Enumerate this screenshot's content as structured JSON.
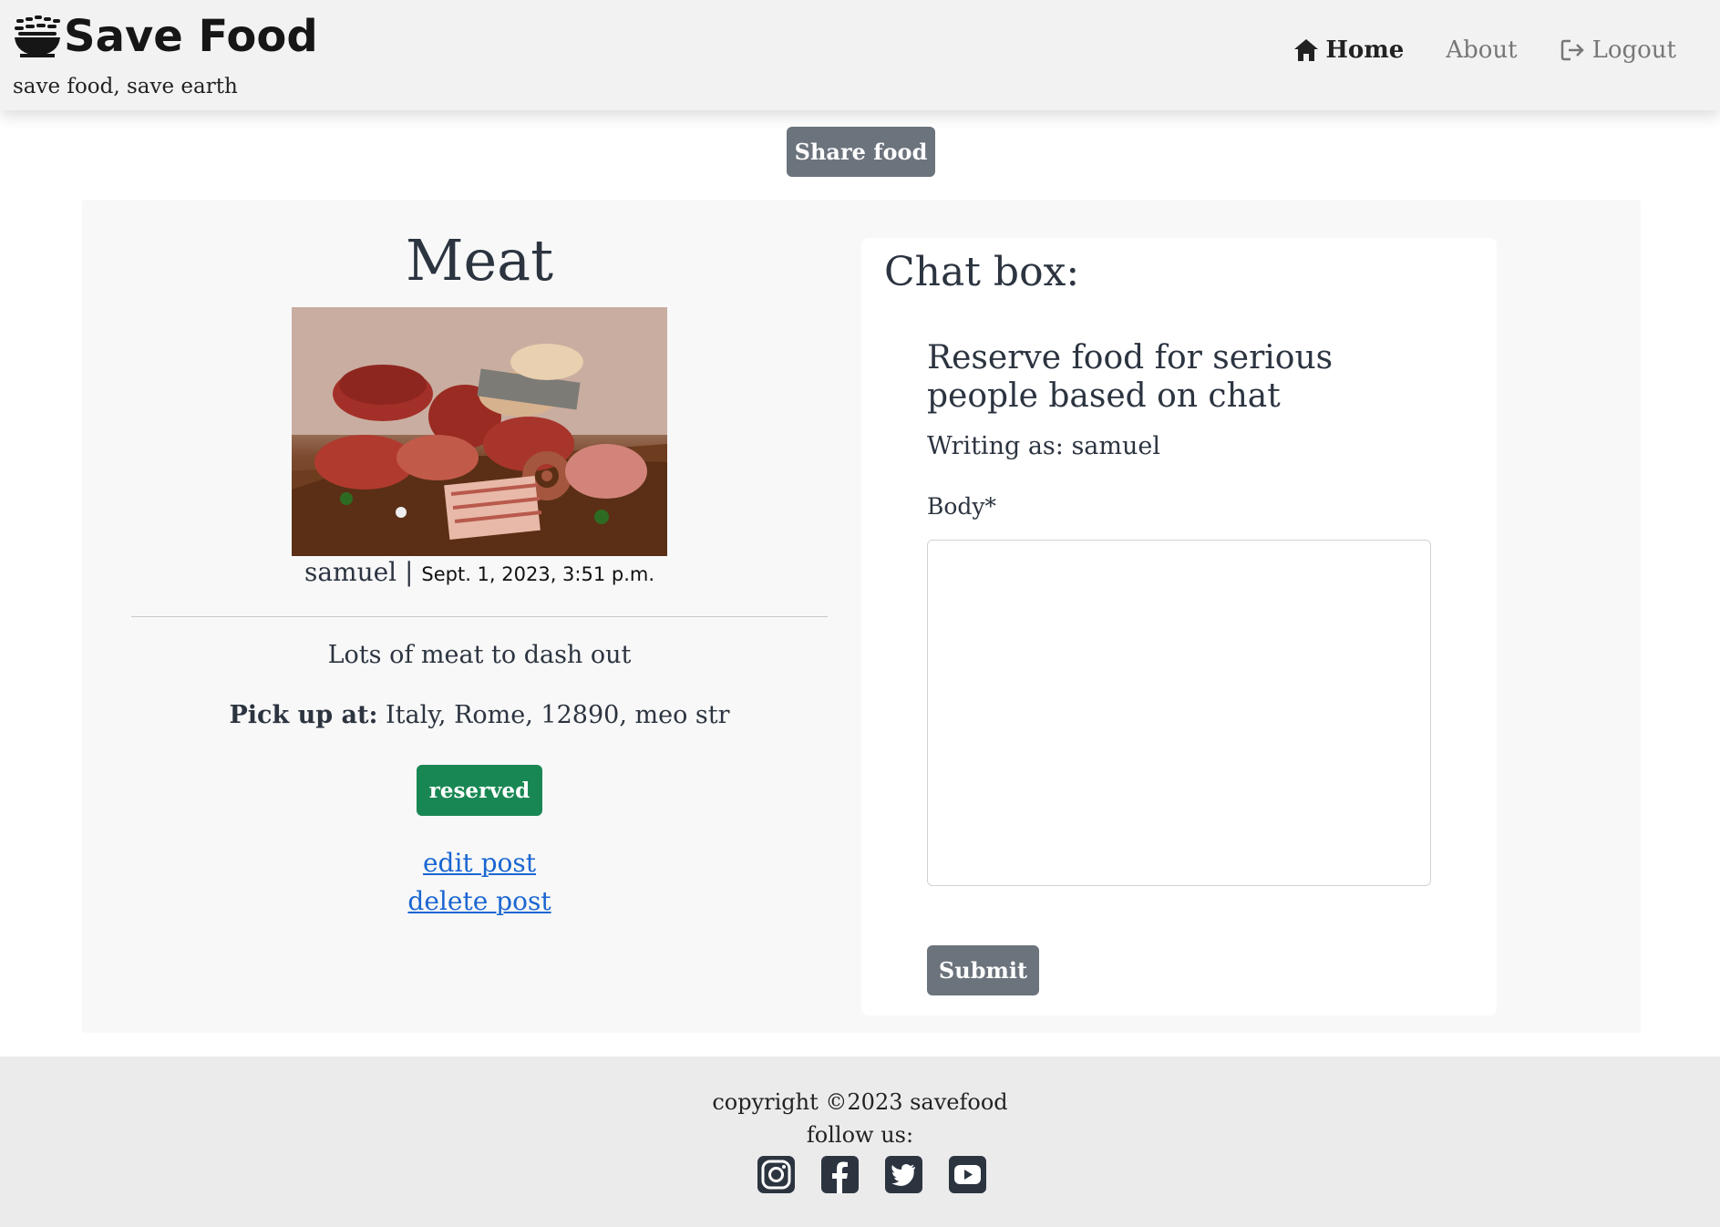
{
  "navbar": {
    "brand": "Save Food",
    "tagline": "save food, save earth",
    "links": [
      {
        "label": "Home",
        "icon": "home-icon",
        "active": true
      },
      {
        "label": "About"
      },
      {
        "label": "Logout",
        "icon": "logout-icon"
      }
    ]
  },
  "share_button": "Share food",
  "post": {
    "title": "Meat",
    "image_icon": "meat-photo",
    "author": "samuel",
    "separator": "|",
    "date": "Sept. 1, 2023, 3:51 p.m.",
    "description": "Lots of meat to dash out",
    "pickup_label": "Pick up at:",
    "pickup_address": "Italy, Rome, 12890, meo str",
    "status": "reserved",
    "status_color": "#198754",
    "edit_link": "edit post",
    "delete_link": "delete post"
  },
  "chat": {
    "title": "Chat box:",
    "heading": "Reserve food for serious people based on chat",
    "writing_as": "Writing as: samuel",
    "body_label": "Body*",
    "body_value": "",
    "submit": "Submit"
  },
  "footer": {
    "copyright": "copyright ©2023 savefood",
    "follow": "follow us:",
    "social_icons": [
      "instagram-icon",
      "facebook-icon",
      "twitter-icon",
      "youtube-icon"
    ]
  },
  "colors": {
    "link": "#1a66d1",
    "button": "#6b737c",
    "navbar_bg": "#f2f2f3",
    "footer_bg": "#ebebec"
  }
}
